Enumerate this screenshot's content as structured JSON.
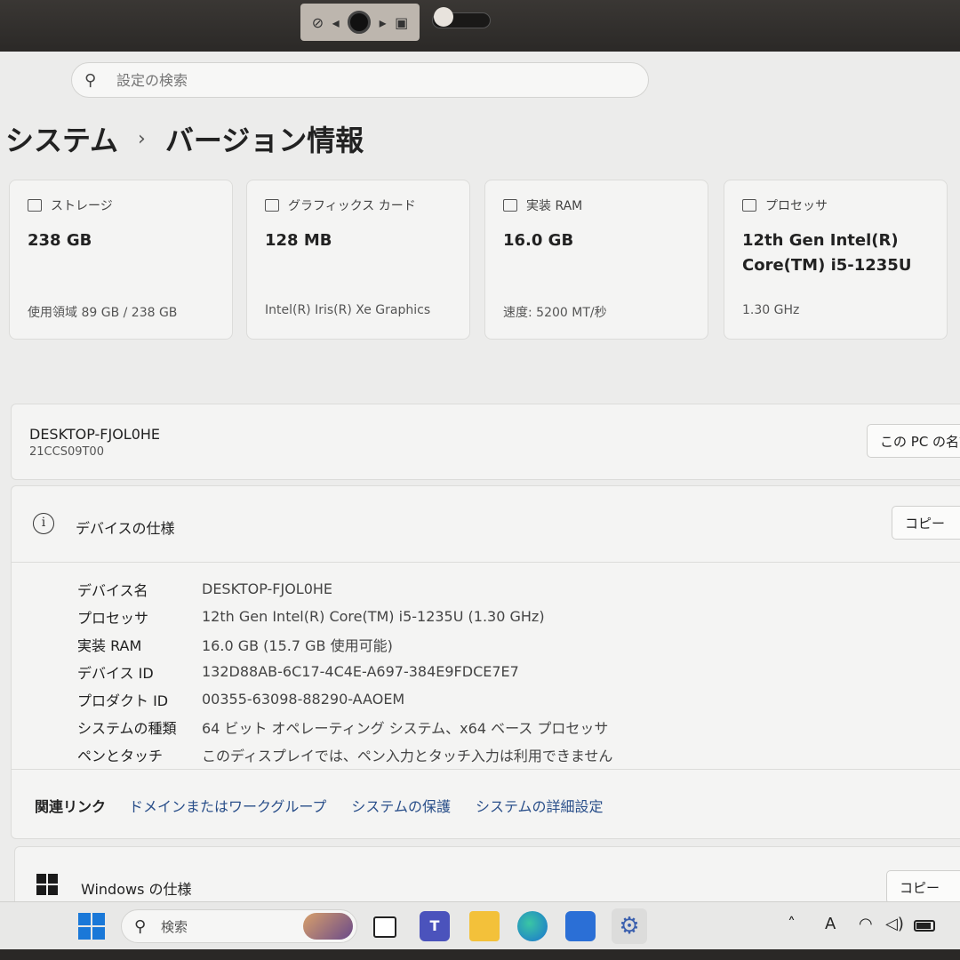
{
  "search": {
    "placeholder": "設定の検索"
  },
  "breadcrumb": {
    "parent": "システム",
    "separator": "›",
    "current": "バージョン情報"
  },
  "cards": [
    {
      "title": "ストレージ",
      "value": "238 GB",
      "sub": "使用領域 89 GB / 238 GB",
      "icon": "storage-icon"
    },
    {
      "title": "グラフィックス カード",
      "value": "128 MB",
      "sub": "Intel(R) Iris(R) Xe Graphics",
      "icon": "graphics-card-icon"
    },
    {
      "title": "実装 RAM",
      "value": "16.0 GB",
      "sub": "速度: 5200 MT/秒",
      "icon": "ram-icon"
    },
    {
      "title": "プロセッサ",
      "value": "12th Gen Intel(R) Core(TM) i5-1235U",
      "sub": "1.30 GHz",
      "icon": "processor-icon"
    }
  ],
  "device": {
    "name": "DESKTOP-FJOL0HE",
    "model": "21CCS09T00",
    "rename_label": "この PC の名前を変更"
  },
  "device_specs": {
    "title": "デバイスの仕様",
    "copy_label": "コピー",
    "rows": [
      {
        "key": "デバイス名",
        "value": "DESKTOP-FJOL0HE"
      },
      {
        "key": "プロセッサ",
        "value": "12th Gen Intel(R) Core(TM) i5-1235U (1.30 GHz)"
      },
      {
        "key": "実装 RAM",
        "value": "16.0 GB (15.7 GB 使用可能)"
      },
      {
        "key": "デバイス ID",
        "value": "132D88AB-6C17-4C4E-A697-384E9FDCE7E7"
      },
      {
        "key": "プロダクト ID",
        "value": "00355-63098-88290-AAOEM"
      },
      {
        "key": "システムの種類",
        "value": "64 ビット オペレーティング システム、x64 ベース プロセッサ"
      },
      {
        "key": "ペンとタッチ",
        "value": "このディスプレイでは、ペン入力とタッチ入力は利用できません"
      }
    ]
  },
  "related_links": {
    "label": "関連リンク",
    "links": [
      "ドメインまたはワークグループ",
      "システムの保護",
      "システムの詳細設定"
    ]
  },
  "windows_specs": {
    "title": "Windows の仕様",
    "copy_label": "コピー"
  },
  "taskbar": {
    "search_label": "検索",
    "tray_input": "A"
  }
}
